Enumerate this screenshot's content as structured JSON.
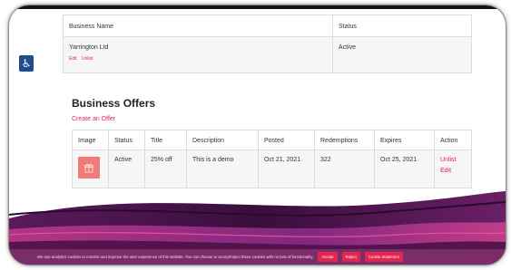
{
  "business_table": {
    "headers": [
      "Business Name",
      "Status"
    ],
    "name": "Yarrington Ltd",
    "status": "Active",
    "links": [
      "Edit",
      "Unlist"
    ]
  },
  "offers": {
    "title": "Business Offers",
    "create_link": "Create an Offer",
    "headers": [
      "Image",
      "Status",
      "Title",
      "Description",
      "Posted",
      "Redemptions",
      "Expires",
      "Action"
    ],
    "row": {
      "status": "Active",
      "title": "25% off",
      "description": "This is a demo",
      "posted": "Oct 21, 2021",
      "redemptions": "322",
      "expires": "Oct 25, 2021",
      "actions": [
        "Unlist",
        "Edit"
      ]
    }
  },
  "accessibility": {
    "icon": "wheelchair-icon",
    "glyph": "♿"
  },
  "cookie_bar": {
    "text": "We use analytics cookies to monitor and improve the user experience of this website. You can choose to accept/reject these cookies with no loss of functionality.",
    "buttons": [
      "Accept",
      "Reject",
      "Cookie Statement"
    ]
  },
  "colors": {
    "accent": "#e1264f",
    "thumb": "#ef7b78",
    "cookie_bar": "#7b2d6a",
    "wave_dark": "#4a1146",
    "wave_purple": "#8e2c8a",
    "accessibility": "#1d4c8f"
  }
}
